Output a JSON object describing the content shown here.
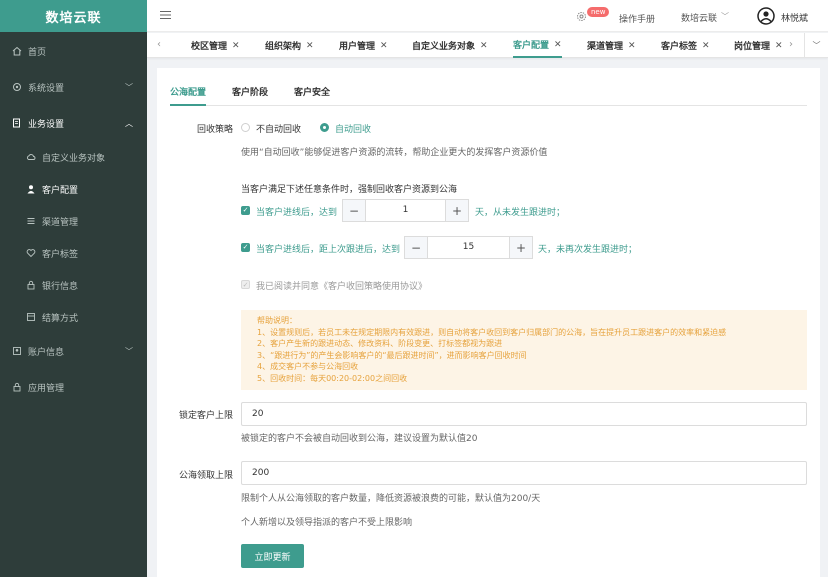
{
  "app": {
    "title": "数培云联"
  },
  "sidebar": {
    "items": [
      {
        "label": "首页"
      },
      {
        "label": "系统设置"
      },
      {
        "label": "业务设置"
      },
      {
        "label": "账户信息"
      },
      {
        "label": "应用管理"
      }
    ],
    "business_sub": [
      {
        "label": "自定义业务对象"
      },
      {
        "label": "客户配置"
      },
      {
        "label": "渠道管理"
      },
      {
        "label": "客户标签"
      },
      {
        "label": "银行信息"
      },
      {
        "label": "结算方式"
      }
    ]
  },
  "topbar": {
    "new_badge": "new",
    "manual": "操作手册",
    "org": "数培云联",
    "user": "林悦斌"
  },
  "tabs": [
    {
      "label": "校区管理"
    },
    {
      "label": "组织架构"
    },
    {
      "label": "用户管理"
    },
    {
      "label": "自定义业务对象"
    },
    {
      "label": "客户配置"
    },
    {
      "label": "渠道管理"
    },
    {
      "label": "客户标签"
    },
    {
      "label": "岗位管理"
    }
  ],
  "subtabs": [
    {
      "label": "公海配置"
    },
    {
      "label": "客户阶段"
    },
    {
      "label": "客户安全"
    }
  ],
  "form": {
    "policy_label": "回收策略",
    "opt_manual": "不自动回收",
    "opt_auto": "自动回收",
    "policy_desc": "使用“自动回收”能够促进客户资源的流转，帮助企业更大的发挥客户资源价值",
    "condition_title": "当客户满足下述任意条件时，强制回收客户资源到公海",
    "cond1_prefix": "当客户进线后，达到",
    "cond1_value": "1",
    "cond1_suffix": "天，从未发生跟进时；",
    "cond2_prefix": "当客户进线后，距上次跟进后，达到",
    "cond2_value": "15",
    "cond2_suffix": "天，未再次发生跟进时；",
    "agree": "我已阅读并同意《客户收回策略使用协议》",
    "help_lines": [
      "帮助说明：",
      "1、设置规则后，若员工未在规定期限内有效跟进，则自动将客户收回到客户归属部门的公海，旨在提升员工跟进客户的效率和紧迫感",
      "2、客户产生新的跟进动态、修改资料、阶段变更、打标签都视为跟进",
      "3、“跟进行为”的产生会影响客户的“最后跟进时间”，进而影响客户回收时间",
      "4、成交客户不参与公海回收",
      "5、回收时间：每天00:20-02:00之间回收"
    ],
    "lock_label": "锁定客户上限",
    "lock_value": "20",
    "lock_desc": "被锁定的客户不会被自动回收到公海，建议设置为默认值20",
    "claim_label": "公海领取上限",
    "claim_value": "200",
    "claim_desc": "限制个人从公海领取的客户数量，降低资源被浪费的可能，默认值为200/天",
    "claim_note": "个人新增以及领导指派的客户不受上限影响",
    "submit": "立即更新"
  },
  "colors": {
    "accent": "#3e9c8e",
    "sidebar": "#2e3d3a",
    "warning": "#e6a23c"
  }
}
